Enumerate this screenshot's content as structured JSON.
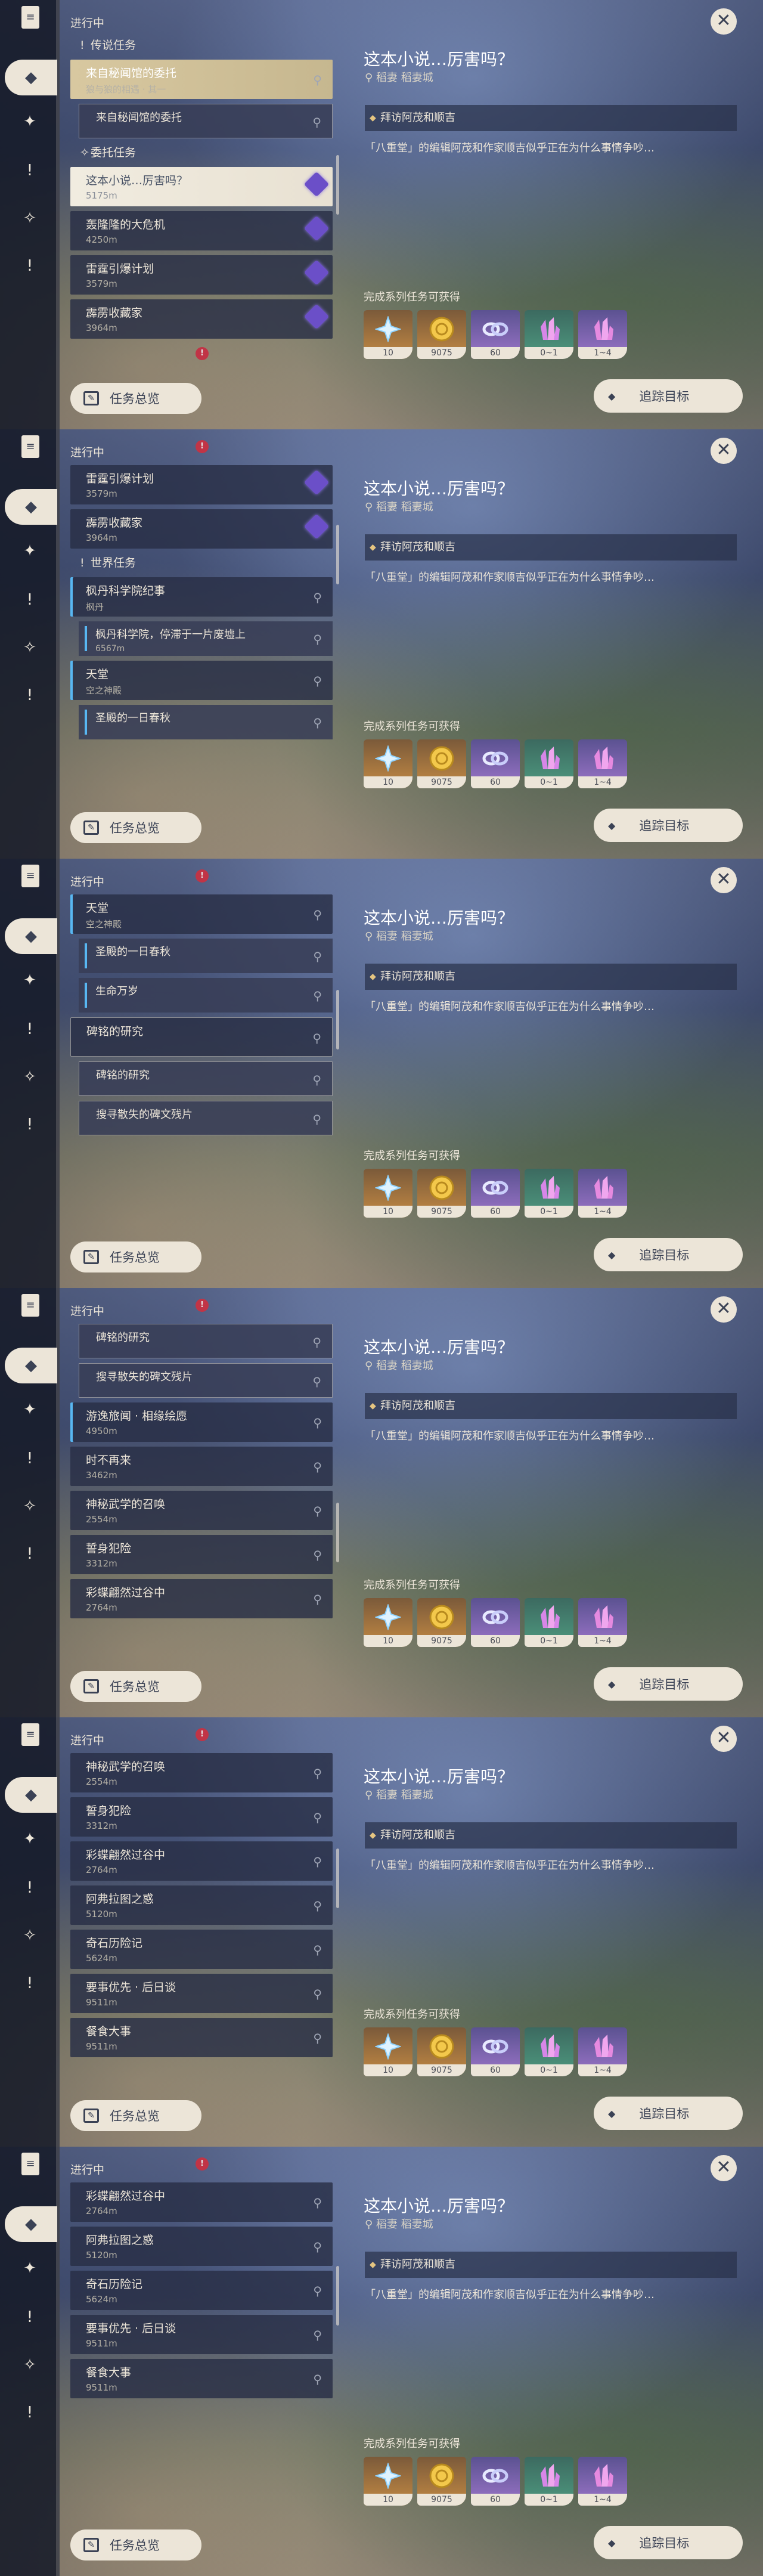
{
  "rail": {
    "book_icon": "book-icon",
    "icons": [
      "quest-icon",
      "compass-icon",
      "alert-icon",
      "star-icon",
      "alert-icon"
    ]
  },
  "status_label": "进行中",
  "overview_label": "任务总览",
  "track_label": "追踪目标",
  "detail": {
    "title": "这本小说…厉害吗？",
    "location": "稻妻 稻妻城",
    "step": "拜访阿茂和顺吉",
    "description": "「八重堂」的编辑阿茂和作家顺吉似乎正在为什么事情争吵…",
    "rewards_label": "完成系列任务可获得",
    "rewards": [
      {
        "name": "primogem",
        "count": "10",
        "color": "#c38a44"
      },
      {
        "name": "mora",
        "count": "9075",
        "color": "#7b5a3a"
      },
      {
        "name": "exp",
        "count": "60",
        "color": "#5b5291"
      },
      {
        "name": "crystal-green",
        "count": "0~1",
        "color": "#3c6a60"
      },
      {
        "name": "crystal-purple",
        "count": "1~4",
        "color": "#5b5291"
      }
    ]
  },
  "frames": [
    {
      "rows": [
        {
          "kind": "cat",
          "title": "传说任务",
          "icon": "alert-icon"
        },
        {
          "kind": "card",
          "style": "hl",
          "title": "来自秘闻馆的委托",
          "subtitle": "狼与狼的相遇 · 其一"
        },
        {
          "kind": "sub",
          "title": "来自秘闻馆的委托",
          "subtitle": ""
        },
        {
          "kind": "cat",
          "title": "委托任务",
          "icon": "star-icon"
        },
        {
          "kind": "card",
          "style": "sel",
          "title": "这本小说…厉害吗？",
          "subtitle": "5175m",
          "diamond": true
        },
        {
          "kind": "card",
          "title": "轰隆隆的大危机",
          "subtitle": "4250m",
          "diamond": true
        },
        {
          "kind": "card",
          "title": "雷霆引爆计划",
          "subtitle": "3579m",
          "diamond": true
        },
        {
          "kind": "card",
          "title": "霹雳收藏家",
          "subtitle": "3964m",
          "diamond": true
        }
      ]
    },
    {
      "rows": [
        {
          "kind": "card",
          "title": "雷霆引爆计划",
          "subtitle": "3579m",
          "diamond": true
        },
        {
          "kind": "card",
          "title": "霹雳收藏家",
          "subtitle": "3964m",
          "diamond": true
        },
        {
          "kind": "cat",
          "title": "世界任务",
          "icon": "alert-icon"
        },
        {
          "kind": "card",
          "style": "blue",
          "title": "枫丹科学院纪事",
          "subtitle": "枫丹"
        },
        {
          "kind": "sub",
          "title": "枫丹科学院，停滞于一片废墟上",
          "subtitle": "6567m",
          "mark": true
        },
        {
          "kind": "card",
          "style": "blue",
          "title": "天堂",
          "subtitle": "空之神殿"
        },
        {
          "kind": "sub",
          "title": "圣殿的一日春秋",
          "subtitle": "",
          "mark": true
        }
      ]
    },
    {
      "rows": [
        {
          "kind": "card",
          "style": "blue",
          "title": "天堂",
          "subtitle": "空之神殿"
        },
        {
          "kind": "sub",
          "title": "圣殿的一日春秋",
          "subtitle": "",
          "mark": true
        },
        {
          "kind": "sub",
          "title": "生命万岁",
          "subtitle": "",
          "mark": true
        },
        {
          "kind": "card",
          "style": "outline",
          "title": "碑铭的研究",
          "subtitle": ""
        },
        {
          "kind": "sub",
          "title": "碑铭的研究",
          "subtitle": ""
        },
        {
          "kind": "sub",
          "title": "搜寻散失的碑文残片",
          "subtitle": ""
        }
      ]
    },
    {
      "rows": [
        {
          "kind": "sub",
          "title": "碑铭的研究",
          "subtitle": ""
        },
        {
          "kind": "sub",
          "title": "搜寻散失的碑文残片",
          "subtitle": ""
        },
        {
          "kind": "card",
          "style": "blue",
          "title": "游逸旅闻 · 相缘绘愿",
          "subtitle": "4950m"
        },
        {
          "kind": "card",
          "title": "时不再来",
          "subtitle": "3462m"
        },
        {
          "kind": "card",
          "title": "神秘武学的召唤",
          "subtitle": "2554m"
        },
        {
          "kind": "card",
          "title": "誓身犯险",
          "subtitle": "3312m"
        },
        {
          "kind": "card",
          "title": "彩蝶翩然过谷中",
          "subtitle": "2764m"
        }
      ]
    },
    {
      "rows": [
        {
          "kind": "card",
          "title": "神秘武学的召唤",
          "subtitle": "2554m"
        },
        {
          "kind": "card",
          "title": "誓身犯险",
          "subtitle": "3312m"
        },
        {
          "kind": "card",
          "title": "彩蝶翩然过谷中",
          "subtitle": "2764m"
        },
        {
          "kind": "card",
          "title": "阿弗拉图之惑",
          "subtitle": "5120m"
        },
        {
          "kind": "card",
          "title": "奇石历险记",
          "subtitle": "5624m"
        },
        {
          "kind": "card",
          "title": "要事优先 · 后日谈",
          "subtitle": "9511m"
        },
        {
          "kind": "card",
          "title": "餐食大事",
          "subtitle": "9511m"
        }
      ]
    },
    {
      "rows": [
        {
          "kind": "card",
          "title": "彩蝶翩然过谷中",
          "subtitle": "2764m"
        },
        {
          "kind": "card",
          "title": "阿弗拉图之惑",
          "subtitle": "5120m"
        },
        {
          "kind": "card",
          "title": "奇石历险记",
          "subtitle": "5624m"
        },
        {
          "kind": "card",
          "title": "要事优先 · 后日谈",
          "subtitle": "9511m"
        },
        {
          "kind": "card",
          "title": "餐食大事",
          "subtitle": "9511m"
        }
      ]
    }
  ]
}
